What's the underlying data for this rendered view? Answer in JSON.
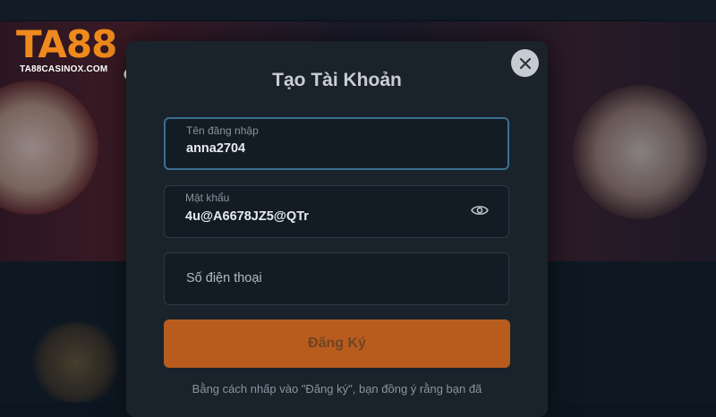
{
  "brand": {
    "logo_text": "TA88",
    "logo_sub": "TA88CASINOX.COM",
    "accent": "#f08a1c"
  },
  "modal": {
    "title": "Tạo Tài Khoản",
    "close_icon": "close-icon"
  },
  "form": {
    "username": {
      "label": "Tên đăng nhập",
      "value": "anna2704"
    },
    "password": {
      "label": "Mật khẩu",
      "value": "4u@A6678JZ5@QTr",
      "toggle_icon": "eye-icon"
    },
    "phone": {
      "placeholder": "Số điện thoại",
      "value": ""
    },
    "submit_label": "Đăng Ký"
  },
  "terms": {
    "line1": "Bằng cách nhấp vào \"Đăng ký\", bạn đồng ý rằng bạn đã"
  },
  "colors": {
    "modal_bg": "#1a232b",
    "field_bg": "#131c24",
    "active_border": "#3b6f91",
    "button_bg": "#b85c1e"
  }
}
